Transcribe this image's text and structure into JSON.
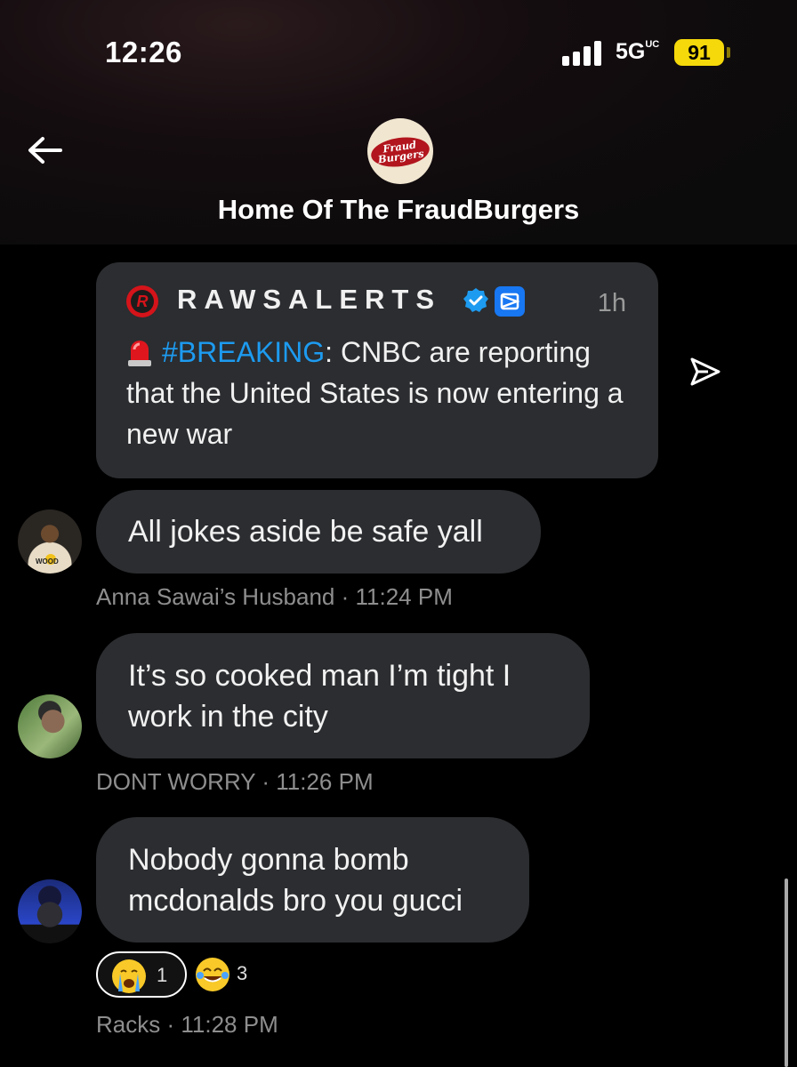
{
  "status_bar": {
    "time": "12:26",
    "network": "5G",
    "network_suffix": "UC",
    "battery": "91",
    "colors": {
      "battery": "#f5d90a"
    }
  },
  "header": {
    "logo_line1": "Fraud",
    "logo_line2": "Burgers",
    "title": "Home Of The FraudBurgers",
    "back_icon": "arrow-left-icon"
  },
  "shared_post": {
    "source_name": "RAWSALERTS",
    "age": "1h",
    "hashtag": "#BREAKING",
    "text": ": CNBC are reporting that the United States is now entering a new war",
    "icons": [
      "siren-icon",
      "verified-badge-icon",
      "affiliate-badge-icon"
    ],
    "colors": {
      "hashtag": "#1d9bf0",
      "verified": "#1d9bf0",
      "bubble": "#2b2d30"
    }
  },
  "share_icon": "send-icon",
  "messages": [
    {
      "text": "All jokes aside be safe yall",
      "sender": "Anna Sawai’s Husband",
      "time": "11:24 PM"
    },
    {
      "text": "It’s so cooked man I’m tight I work in the city",
      "sender": "DONT WORRY ",
      "time": "11:26 PM"
    },
    {
      "text": "Nobody gonna bomb mcdonalds bro you gucci",
      "sender": "Racks",
      "time": "11:28 PM"
    }
  ],
  "reactions": [
    {
      "emoji": "crying-face-emoji",
      "count": "1",
      "selected": true
    },
    {
      "emoji": "tears-of-joy-emoji",
      "count": "3",
      "selected": false
    }
  ]
}
